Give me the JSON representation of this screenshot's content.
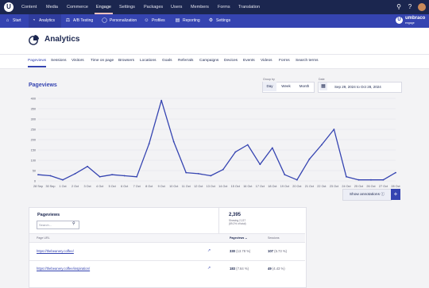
{
  "topnav": {
    "items": [
      {
        "label": "Content",
        "active": false
      },
      {
        "label": "Media",
        "active": false
      },
      {
        "label": "Commerce",
        "active": false
      },
      {
        "label": "Engage",
        "active": true
      },
      {
        "label": "Settings",
        "active": false
      },
      {
        "label": "Packages",
        "active": false
      },
      {
        "label": "Users",
        "active": false
      },
      {
        "label": "Members",
        "active": false
      },
      {
        "label": "Forms",
        "active": false
      },
      {
        "label": "Translation",
        "active": false
      }
    ]
  },
  "subnav": {
    "items": [
      {
        "label": "Start",
        "icon": "home-icon",
        "active": false
      },
      {
        "label": "Analytics",
        "icon": "analytics-icon",
        "active": true
      },
      {
        "label": "A/B Testing",
        "icon": "ab-testing-icon",
        "active": false
      },
      {
        "label": "Personalization",
        "icon": "personalization-icon",
        "active": false
      },
      {
        "label": "Profiles",
        "icon": "profiles-icon",
        "active": false
      },
      {
        "label": "Reporting",
        "icon": "reporting-icon",
        "active": false
      },
      {
        "label": "Settings",
        "icon": "gear-icon",
        "active": false
      }
    ]
  },
  "brand": {
    "name": "umbraco",
    "product": "engage"
  },
  "page": {
    "title": "Analytics"
  },
  "tabs": [
    "Pageviews",
    "Sessions",
    "Visitors",
    "Time on page",
    "Browsers",
    "Locations",
    "Goals",
    "Referrals",
    "Campaigns",
    "Devices",
    "Events",
    "Videos",
    "Forms",
    "Search terms"
  ],
  "active_tab": "Pageviews",
  "section": {
    "title": "Pageviews"
  },
  "controls": {
    "group_by_label": "Group by",
    "group_by_options": [
      "Day",
      "Week",
      "Month"
    ],
    "group_by_selected": "Day",
    "date_label": "Date",
    "date_range": "Sep 29, 2024 to Oct 28, 2024"
  },
  "chart_data": {
    "type": "line",
    "x": [
      "28 Sep",
      "30 Sep",
      "1 Oct",
      "2 Oct",
      "3 Oct",
      "4 Oct",
      "5 Oct",
      "6 Oct",
      "7 Oct",
      "8 Oct",
      "9 Oct",
      "10 Oct",
      "11 Oct",
      "12 Oct",
      "13 Oct",
      "14 Oct",
      "15 Oct",
      "16 Oct",
      "17 Oct",
      "18 Oct",
      "19 Oct",
      "20 Oct",
      "21 Oct",
      "22 Oct",
      "23 Oct",
      "24 Oct",
      "25 Oct",
      "26 Oct",
      "27 Oct",
      "28 Oct"
    ],
    "values": [
      30,
      25,
      5,
      35,
      70,
      20,
      30,
      25,
      20,
      180,
      390,
      190,
      40,
      35,
      25,
      55,
      140,
      175,
      80,
      160,
      30,
      5,
      105,
      175,
      250,
      20,
      5,
      5,
      5,
      40
    ],
    "yticks": [
      0,
      50,
      100,
      150,
      200,
      250,
      300,
      350,
      400
    ],
    "ylim": [
      0,
      400
    ],
    "grid": true,
    "color": "#3544b1"
  },
  "annotations": {
    "show_label": "Show annotations",
    "add_label": "+"
  },
  "table": {
    "title": "Pageviews",
    "search_placeholder": "Search...",
    "total": "2,395",
    "stat_lines": [
      "Showing 2,137",
      "(89.2% of total)"
    ],
    "headers": {
      "url": "Page URL",
      "pageviews": "Pageviews",
      "sessions": "Sessions"
    },
    "rows": [
      {
        "url": "https://thebeanery.coffee/",
        "pageviews": "330",
        "pageviews_pct": "(13.78 %)",
        "sessions": "107",
        "sessions_pct": "(5.73 %)"
      },
      {
        "url": "https://thebeanery.coffee/inspiration/",
        "pageviews": "183",
        "pageviews_pct": "(7.64 %)",
        "sessions": "49",
        "sessions_pct": "(4.43 %)"
      }
    ]
  }
}
